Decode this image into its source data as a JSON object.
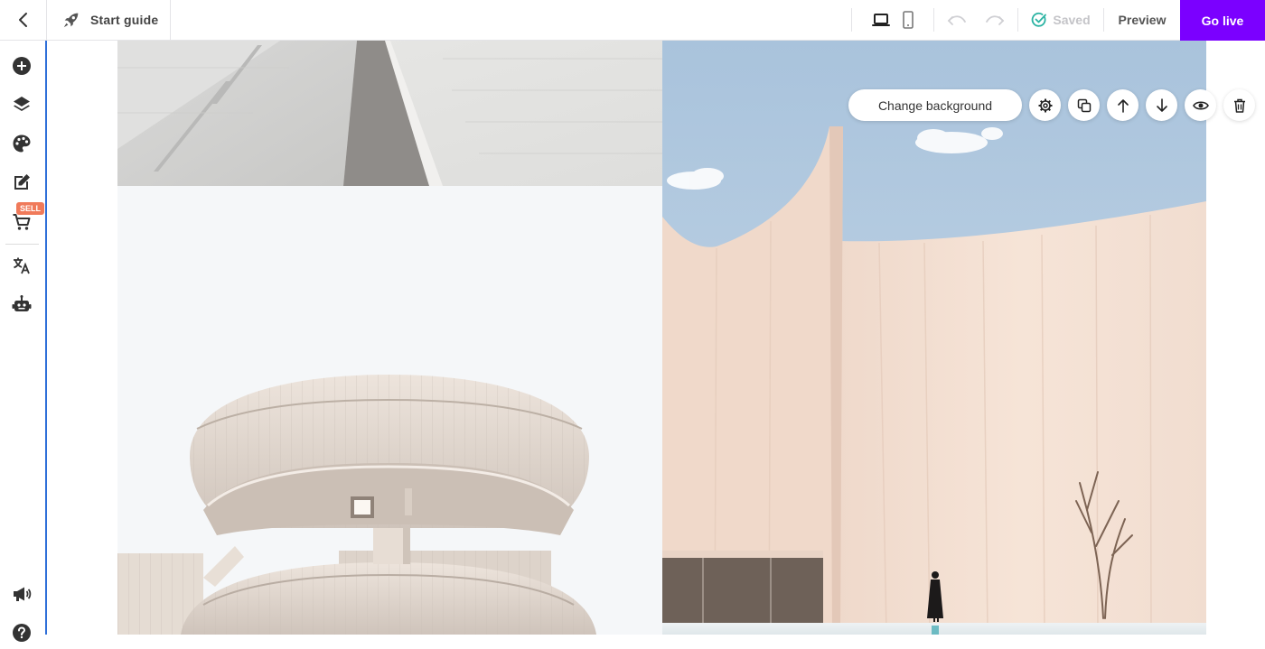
{
  "topbar": {
    "start_guide_label": "Start guide",
    "saved_label": "Saved",
    "preview_label": "Preview",
    "go_live_label": "Go live",
    "icons": {
      "back": "chevron-left-icon",
      "start_guide": "rocket-icon",
      "desktop": "laptop-icon",
      "mobile": "phone-icon",
      "undo": "undo-icon",
      "redo": "redo-icon",
      "saved": "check-circle-icon"
    }
  },
  "sidebar": {
    "sell_badge": "SELL",
    "items": [
      {
        "icon": "add-circle-icon"
      },
      {
        "icon": "layers-icon"
      },
      {
        "icon": "palette-icon"
      },
      {
        "icon": "edit-icon"
      },
      {
        "icon": "cart-icon"
      },
      {
        "icon": "translate-icon"
      },
      {
        "icon": "robot-icon"
      },
      {
        "icon": "megaphone-icon"
      },
      {
        "icon": "help-icon"
      }
    ]
  },
  "section_toolbar": {
    "change_background_label": "Change background",
    "buttons": [
      "gear-icon",
      "duplicate-icon",
      "arrow-up-icon",
      "arrow-down-icon",
      "eye-icon",
      "trash-icon"
    ]
  },
  "colors": {
    "accent": "#7b00ff",
    "selection_border": "#2f6fd8",
    "sell_badge": "#f07a5a",
    "saved_check": "#2bb3a3",
    "panel_bg": "#f5f7f9"
  }
}
